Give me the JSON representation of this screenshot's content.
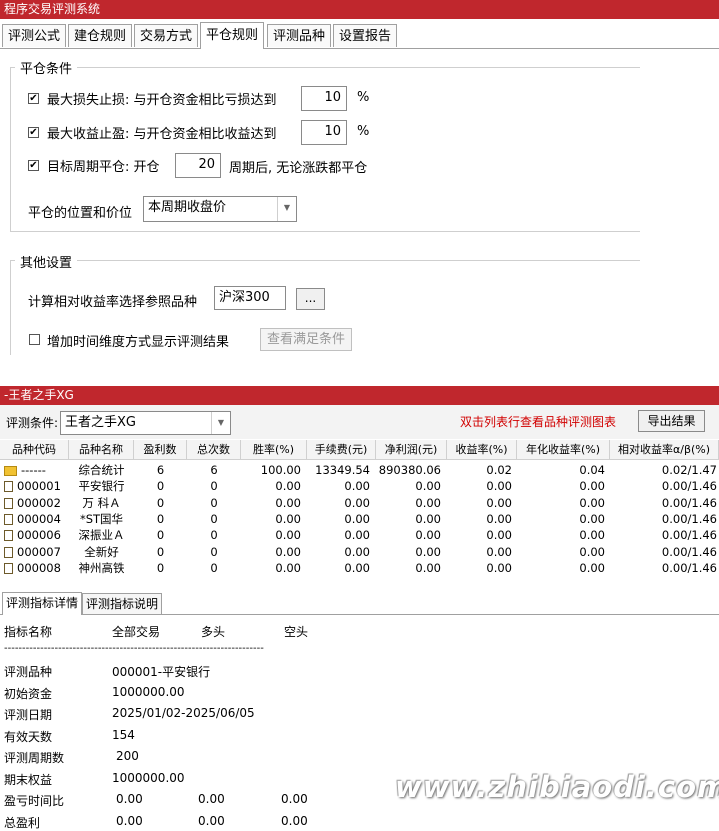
{
  "top_window": {
    "title": "程序交易评测系统",
    "tabs": [
      {
        "label": "评测公式"
      },
      {
        "label": "建仓规则"
      },
      {
        "label": "交易方式"
      },
      {
        "label": "平仓规则",
        "active": true
      },
      {
        "label": "评测品种"
      },
      {
        "label": "设置报告"
      }
    ],
    "close_section": {
      "title": "平仓条件",
      "max_loss": {
        "checked": true,
        "label": "最大损失止损: 与开仓资金相比亏损达到",
        "value": "10",
        "unit": "%"
      },
      "max_profit": {
        "checked": true,
        "label": "最大收益止盈: 与开仓资金相比收益达到",
        "value": "10",
        "unit": "%"
      },
      "target_period": {
        "checked": true,
        "label_before": "目标周期平仓: 开仓",
        "value": "20",
        "label_after": "周期后, 无论涨跌都平仓"
      },
      "position_label": "平仓的位置和价位",
      "position_value": "本周期收盘价"
    },
    "other_section": {
      "title": "其他设置",
      "ref_label": "计算相对收益率选择参照品种",
      "ref_value": "沪深300",
      "browse_label": "...",
      "time_dim": {
        "checked": false,
        "label": "增加时间维度方式显示评测结果"
      },
      "view_button": "查看满足条件"
    }
  },
  "bottom_window": {
    "title": "-王者之手XG",
    "condition_label": "评测条件:",
    "condition_value": "王者之手XG",
    "hint": "双击列表行查看品种评测图表",
    "export_button": "导出结果",
    "columns": [
      "品种代码",
      "品种名称",
      "盈利数",
      "总次数",
      "胜率(%)",
      "手续费(元)",
      "净利润(元)",
      "收益率(%)",
      "年化收益率(%)",
      "相对收益率α/β(%)"
    ],
    "rows": [
      {
        "code": "------",
        "name": "综合统计",
        "win": "6",
        "total": "6",
        "rate": "100.00",
        "fee": "13349.54",
        "profit": "890380.06",
        "ret": "0.02",
        "annual": "0.04",
        "rel": "0.02/1.47",
        "icon": "folder-icon"
      },
      {
        "code": "000001",
        "name": "平安银行",
        "win": "0",
        "total": "0",
        "rate": "0.00",
        "fee": "0.00",
        "profit": "0.00",
        "ret": "0.00",
        "annual": "0.00",
        "rel": "0.00/1.46",
        "icon": "doc-icon"
      },
      {
        "code": "000002",
        "name": "万 科Ａ",
        "win": "0",
        "total": "0",
        "rate": "0.00",
        "fee": "0.00",
        "profit": "0.00",
        "ret": "0.00",
        "annual": "0.00",
        "rel": "0.00/1.46",
        "icon": "doc-icon"
      },
      {
        "code": "000004",
        "name": "*ST国华",
        "win": "0",
        "total": "0",
        "rate": "0.00",
        "fee": "0.00",
        "profit": "0.00",
        "ret": "0.00",
        "annual": "0.00",
        "rel": "0.00/1.46",
        "icon": "doc-icon"
      },
      {
        "code": "000006",
        "name": "深振业Ａ",
        "win": "0",
        "total": "0",
        "rate": "0.00",
        "fee": "0.00",
        "profit": "0.00",
        "ret": "0.00",
        "annual": "0.00",
        "rel": "0.00/1.46",
        "icon": "doc-icon"
      },
      {
        "code": "000007",
        "name": "全新好",
        "win": "0",
        "total": "0",
        "rate": "0.00",
        "fee": "0.00",
        "profit": "0.00",
        "ret": "0.00",
        "annual": "0.00",
        "rel": "0.00/1.46",
        "icon": "doc-icon"
      },
      {
        "code": "000008",
        "name": "神州高铁",
        "win": "0",
        "total": "0",
        "rate": "0.00",
        "fee": "0.00",
        "profit": "0.00",
        "ret": "0.00",
        "annual": "0.00",
        "rel": "0.00/1.46",
        "icon": "doc-icon"
      }
    ],
    "detail_tabs": [
      {
        "label": "评测指标详情",
        "active": true
      },
      {
        "label": "评测指标说明"
      }
    ],
    "detail": {
      "header": [
        "指标名称",
        "全部交易",
        "多头",
        "空头"
      ],
      "separator": "------------------------------------------------------------------------",
      "lines": [
        {
          "label": "评测品种",
          "value": "000001-平安银行"
        },
        {
          "label": "初始资金",
          "value": "1000000.00"
        },
        {
          "label": "评测日期",
          "value": "2025/01/02-2025/06/05"
        },
        {
          "label": "有效天数",
          "value": "154"
        },
        {
          "label": "评测周期数",
          "value": "200"
        },
        {
          "label": "期末权益",
          "value": "1000000.00"
        }
      ],
      "ratio_lines": [
        {
          "label": "盈亏时间比",
          "all": "0.00",
          "long": "0.00",
          "short": "0.00"
        },
        {
          "label": "总盈利",
          "all": "0.00",
          "long": "0.00",
          "short": "0.00"
        }
      ]
    }
  },
  "watermark": "www.zhibiaodi.com"
}
